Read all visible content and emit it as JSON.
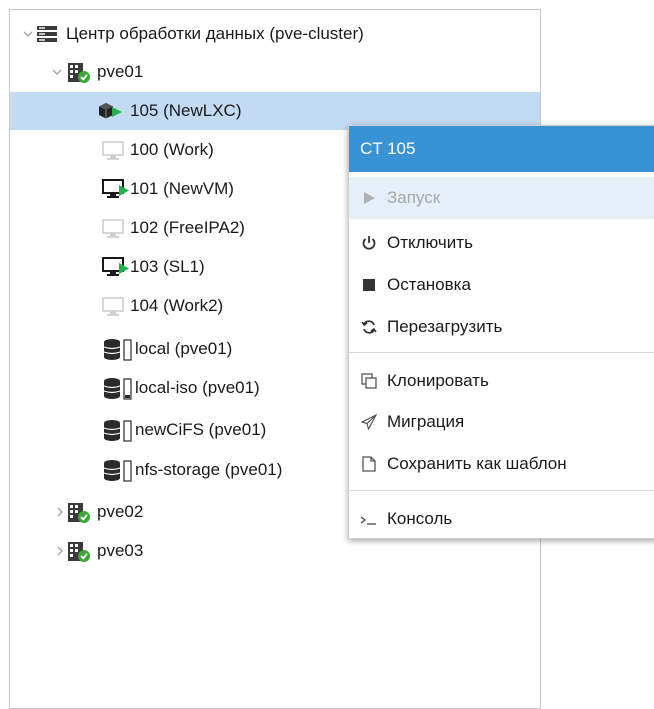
{
  "tree": {
    "datacenter": {
      "label": "Центр обработки данных (pve-cluster)"
    },
    "nodes": {
      "pve01": {
        "label": "pve01"
      },
      "pve02": {
        "label": "pve02"
      },
      "pve03": {
        "label": "pve03"
      }
    },
    "items": [
      {
        "label": "105 (NewLXC)",
        "type": "lxc-running",
        "selected": true
      },
      {
        "label": "100 (Work)",
        "type": "vm-stopped"
      },
      {
        "label": "101 (NewVM)",
        "type": "vm-running"
      },
      {
        "label": "102 (FreeIPA2)",
        "type": "vm-stopped"
      },
      {
        "label": "103 (SL1)",
        "type": "vm-running"
      },
      {
        "label": "104 (Work2)",
        "type": "vm-stopped"
      },
      {
        "label": "local (pve01)",
        "type": "storage"
      },
      {
        "label": "local-iso (pve01)",
        "type": "storage"
      },
      {
        "label": "newCiFS (pve01)",
        "type": "storage"
      },
      {
        "label": "nfs-storage (pve01)",
        "type": "storage"
      }
    ]
  },
  "context_menu": {
    "title": "CT 105",
    "items": [
      {
        "label": "Запуск",
        "icon": "play-icon",
        "disabled": true
      },
      {
        "label": "Отключить",
        "icon": "power-icon"
      },
      {
        "label": "Остановка",
        "icon": "stop-icon"
      },
      {
        "label": "Перезагрузить",
        "icon": "reload-icon"
      },
      {
        "label": "Клонировать",
        "icon": "clone-icon"
      },
      {
        "label": "Миграция",
        "icon": "migrate-icon"
      },
      {
        "label": "Сохранить как шаблон",
        "icon": "template-icon"
      },
      {
        "label": "Консоль",
        "icon": "console-icon"
      }
    ]
  },
  "colors": {
    "selection": "#c3daf3",
    "menu_header": "#3892d4",
    "running_green": "#22b14c",
    "node_ok_green": "#3aa832"
  }
}
